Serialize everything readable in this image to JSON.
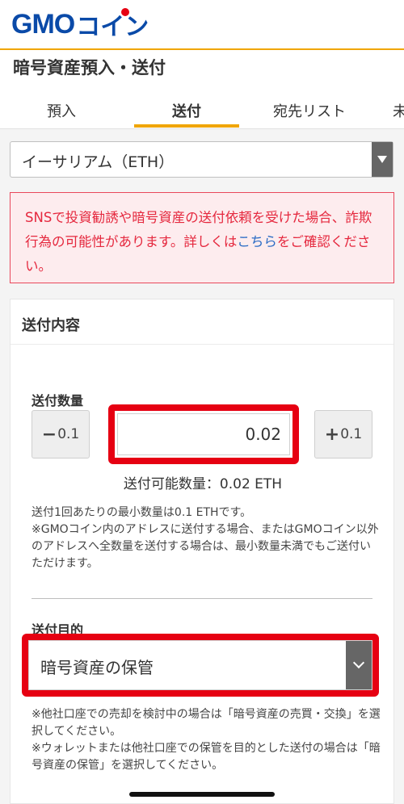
{
  "app": {
    "logo_gmo": "GMO",
    "logo_coin": "コイン"
  },
  "page": {
    "title": "暗号資産預入・送付"
  },
  "tabs": [
    {
      "label": "預入",
      "active": false
    },
    {
      "label": "送付",
      "active": true
    },
    {
      "label": "宛先リスト",
      "active": false
    },
    {
      "label": "未",
      "active": false
    }
  ],
  "currency_select": {
    "value": "イーサリアム（ETH）"
  },
  "warning": {
    "text_before": "SNSで投資勧誘や暗号資産の送付依頼を受けた場合、詐欺行為の可能性があります。詳しくは",
    "link": "こちら",
    "text_after": "をご確認ください。"
  },
  "card": {
    "title": "送付内容",
    "amount_label": "送付数量",
    "minus_button": {
      "sign": "−",
      "value": "0.1"
    },
    "plus_button": {
      "sign": "+",
      "value": "0.1"
    },
    "amount_value": "0.02",
    "available": "送付可能数量：0.02 ETH",
    "note_min": "送付1回あたりの最小数量は0.1 ETHです。",
    "note_gmo": "※GMOコイン内のアドレスに送付する場合、またはGMOコイン以外のアドレスへ全数量を送付する場合は、最小数量未満でもご送付いただけます。",
    "purpose_label": "送付目的",
    "purpose_value": "暗号資産の保管",
    "purpose_note1": "※他社口座での売却を検討中の場合は「暗号資産の売買・交換」を選択してください。",
    "purpose_note2": "※ウォレットまたは他社口座での保管を目的とした送付の場合は「暗号資産の保管」を選択してください。"
  },
  "colors": {
    "brand_blue": "#0a4aa8",
    "accent_orange": "#f0a500",
    "highlight_red": "#e60012",
    "warning_text": "#e5283e"
  }
}
